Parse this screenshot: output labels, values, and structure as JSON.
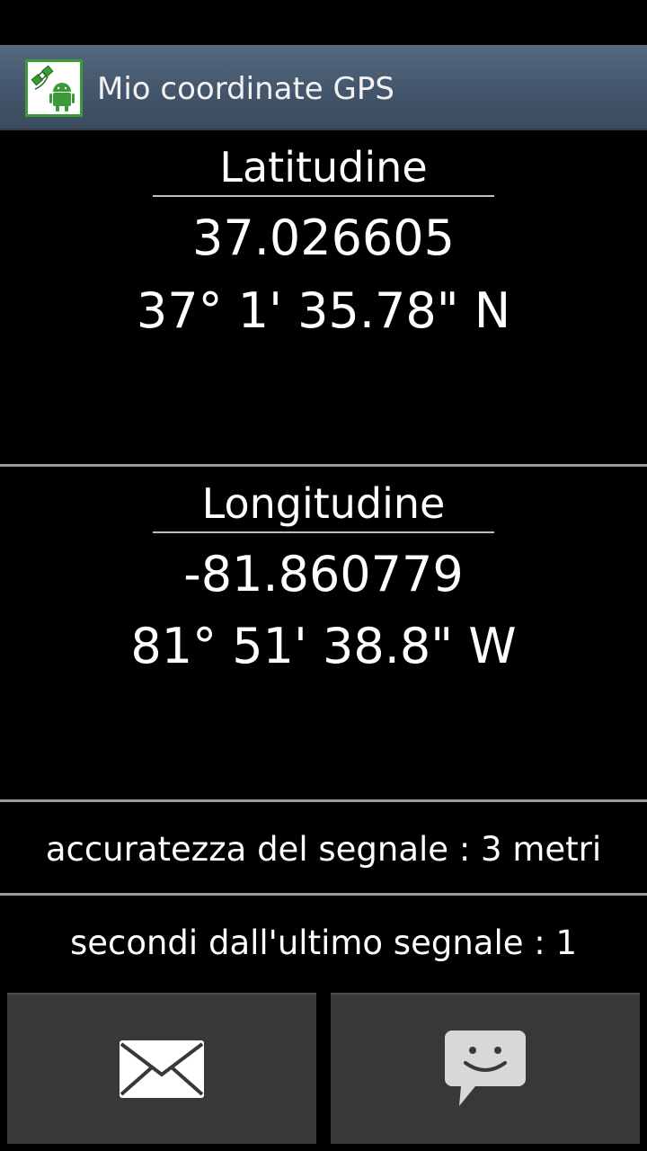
{
  "app": {
    "title": "Mio coordinate GPS",
    "icon": "app-satellite-android-icon"
  },
  "latitude": {
    "label": "Latitudine",
    "decimal": "37.026605",
    "dms": "37° 1' 35.78\" N"
  },
  "longitude": {
    "label": "Longitudine",
    "decimal": "-81.860779",
    "dms": "81° 51' 38.8\" W"
  },
  "accuracy": {
    "text": "accuratezza del segnale : 3 metri"
  },
  "last_signal": {
    "text": "secondi dall'ultimo segnale : 1"
  },
  "actions": {
    "email_icon": "envelope-icon",
    "sms_icon": "chat-bubble-smiley-icon"
  },
  "colors": {
    "background": "#000000",
    "action_bar": "#4a5d72",
    "button": "#383838",
    "divider": "#9a9a9a",
    "icon_green": "#3a9a3a"
  }
}
